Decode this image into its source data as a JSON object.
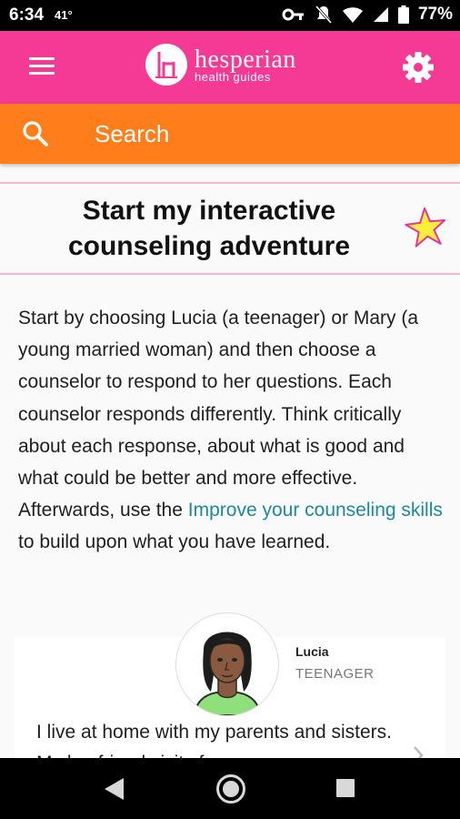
{
  "status_bar": {
    "time": "6:34",
    "temperature": "41°",
    "battery": "77%"
  },
  "app_bar": {
    "logo_name": "hesperian",
    "logo_sub": "health guides"
  },
  "search": {
    "label": "Search"
  },
  "title": {
    "line1": "Start my interactive",
    "line2": "counseling adventure"
  },
  "intro": {
    "text_before_link": "Start by choosing Lucia (a teenager) or Mary (a young married woman) and then choose a counselor to respond to her questions. Each counselor responds differently. Think critically about each response, about what is good and what could be better and more effective. Afterwards, use the ",
    "link_text": "Improve your counseling skills",
    "text_after_link": " to build upon what you have learned."
  },
  "character": {
    "name": "Lucia",
    "role": "TEENAGER",
    "quote": "I live at home with my parents and sisters. My boyfriend visits from"
  },
  "colors": {
    "app_bar": "#f43a95",
    "search_bar": "#ff7e1b",
    "link": "#1b8a9c",
    "star": "#f9ee3b"
  },
  "icons": [
    "menu-icon",
    "settings-icon",
    "search-icon",
    "star-icon",
    "back-icon",
    "home-icon",
    "recent-apps-icon"
  ]
}
